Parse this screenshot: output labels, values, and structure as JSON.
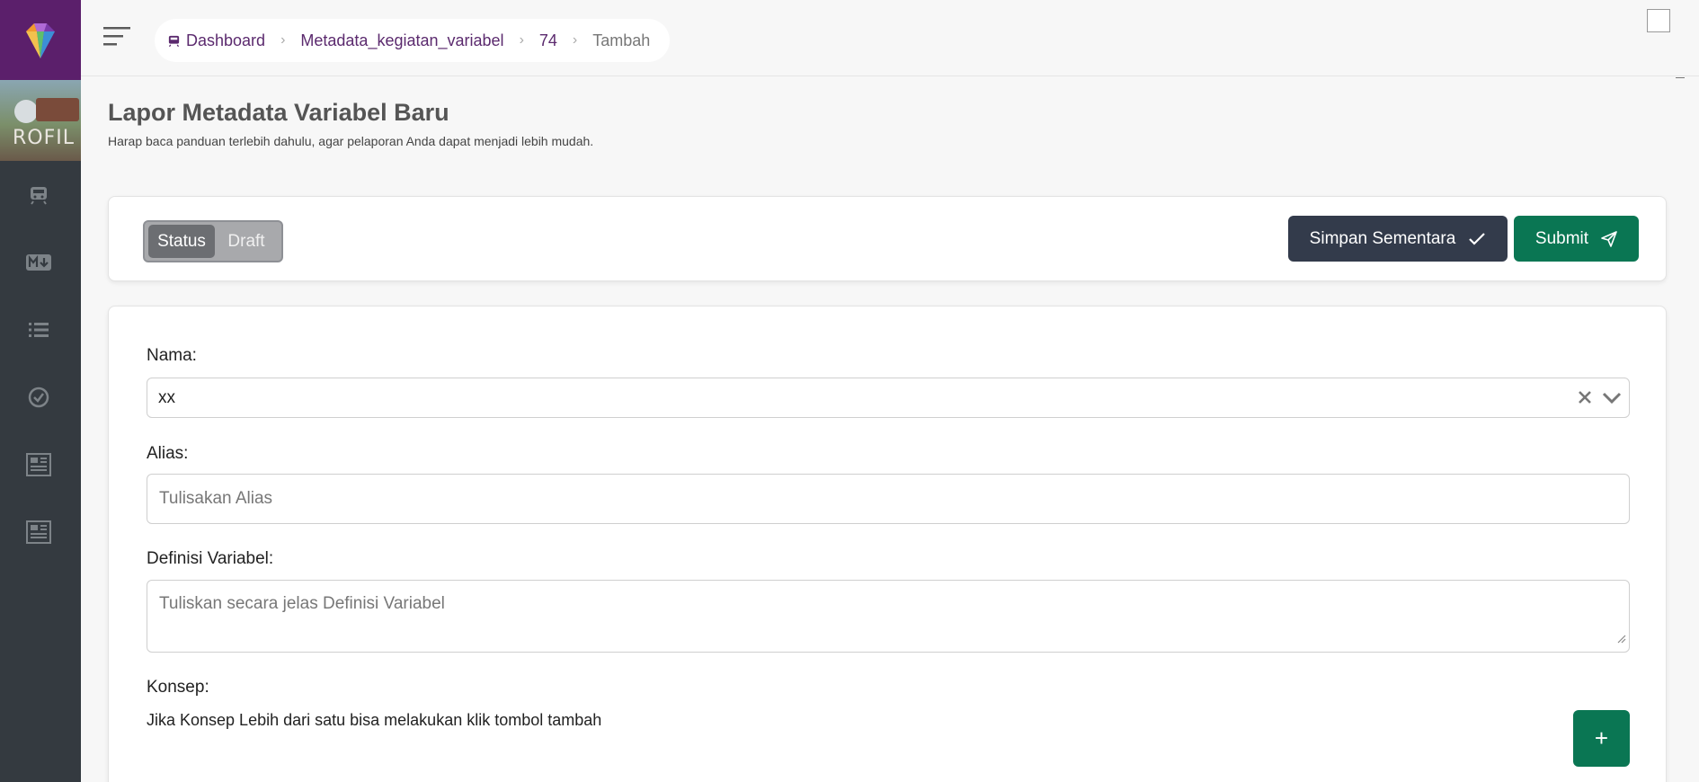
{
  "sidebar": {
    "banner_text": "ROFIL",
    "icons": [
      "train-icon",
      "markdown-icon",
      "list-icon",
      "check-circle-icon",
      "newspaper-icon",
      "newspaper-icon"
    ]
  },
  "breadcrumb": {
    "items": [
      "Dashboard",
      "Metadata_kegiatan_variabel",
      "74",
      "Tambah"
    ]
  },
  "header": {
    "title": "Lapor Metadata Variabel Baru",
    "subtitle": "Harap baca panduan terlebih dahulu, agar pelaporan Anda dapat menjadi lebih mudah."
  },
  "status_toggle": {
    "options": [
      "Status",
      "Draft"
    ],
    "selected": "Status"
  },
  "actions": {
    "save_label": "Simpan Sementara",
    "submit_label": "Submit"
  },
  "form": {
    "nama_label": "Nama:",
    "nama_value": "xx",
    "alias_label": "Alias:",
    "alias_placeholder": "Tulisakan Alias",
    "definisi_label": "Definisi Variabel:",
    "definisi_placeholder": "Tuliskan secara jelas Definisi Variabel",
    "konsep_label": "Konsep:",
    "konsep_note": "Jika Konsep Lebih dari satu bisa melakukan klik tombol tambah",
    "add_label": "+"
  },
  "colors": {
    "brand_purple": "#5b1f6b",
    "sidebar_dark": "#343a40",
    "save_button": "#333b4b",
    "submit_button": "#0a7653"
  }
}
